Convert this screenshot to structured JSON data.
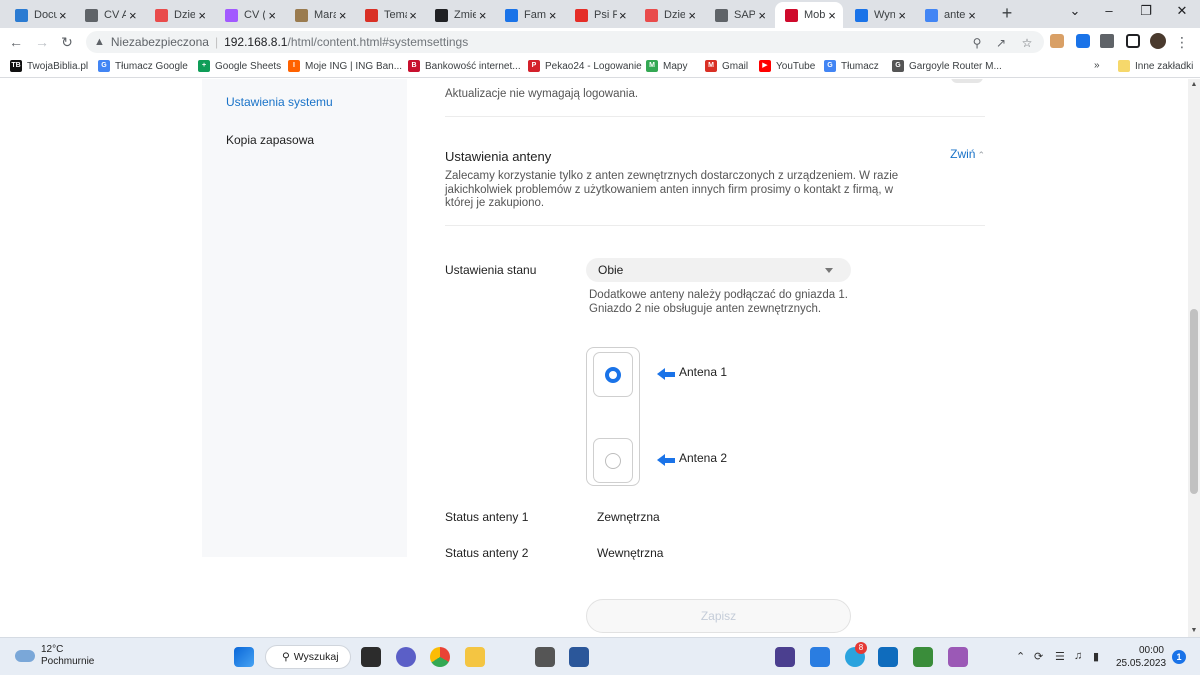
{
  "browser": {
    "tabs": [
      {
        "title": "Docu",
        "icon": "vscode-icon",
        "color": "#2b7bd2"
      },
      {
        "title": "CV A",
        "icon": "globe-icon",
        "color": "#5f6368"
      },
      {
        "title": "Dzie",
        "icon": "youtube-icon",
        "color": "#e94b4b"
      },
      {
        "title": "CV (",
        "icon": "figma-icon",
        "color": "#a259ff"
      },
      {
        "title": "Mara",
        "icon": "link-icon",
        "color": "#9a7b4f"
      },
      {
        "title": "Tema",
        "icon": "gmail-icon",
        "color": "#d93025"
      },
      {
        "title": "Zmie",
        "icon": "edge-icon",
        "color": "#202124"
      },
      {
        "title": "Fami",
        "icon": "globe-icon",
        "color": "#1a73e8"
      },
      {
        "title": "Psi P",
        "icon": "youtube-icon",
        "color": "#e52d27"
      },
      {
        "title": "Dzie",
        "icon": "youtube-icon",
        "color": "#e94b4b"
      },
      {
        "title": "SAP",
        "icon": "globe-icon",
        "color": "#5f6368"
      },
      {
        "title": "Mob",
        "icon": "huawei-icon",
        "color": "#cf0a2c",
        "active": true
      },
      {
        "title": "Wyn",
        "icon": "speedometer-icon",
        "color": "#1a73e8"
      },
      {
        "title": "ante",
        "icon": "google-icon",
        "color": "#4285f4"
      }
    ],
    "new_tab": "+",
    "window_controls": [
      "⌄",
      "–",
      "❐",
      "✕"
    ],
    "omnibox": {
      "security_label": "Niezabezpieczona",
      "host": "192.168.8.1",
      "path": "/html/content.html#systemsettings"
    },
    "bookmarks": [
      {
        "label": "TwojaBiblia.pl",
        "badge": "TB",
        "color": "#111111"
      },
      {
        "label": "Tłumacz Google",
        "badge": "G",
        "color": "#4285f4"
      },
      {
        "label": "Google Sheets",
        "badge": "+",
        "color": "#0f9d58"
      },
      {
        "label": "Moje ING | ING Ban...",
        "badge": "I",
        "color": "#ff6200"
      },
      {
        "label": "Bankowość internet...",
        "badge": "B",
        "color": "#c8102e"
      },
      {
        "label": "Pekao24 - Logowanie",
        "badge": "P",
        "color": "#d4212b"
      },
      {
        "label": "Mapy",
        "badge": "M",
        "color": "#34a853"
      },
      {
        "label": "Gmail",
        "badge": "M",
        "color": "#d93025"
      },
      {
        "label": "YouTube",
        "badge": "▶",
        "color": "#ff0000"
      },
      {
        "label": "Tłumacz",
        "badge": "G",
        "color": "#4285f4"
      },
      {
        "label": "Gargoyle Router M...",
        "badge": "G",
        "color": "#555555"
      }
    ],
    "bookmarks_overflow": "»",
    "other_bookmarks": "Inne zakładki"
  },
  "sidebar": {
    "items": [
      {
        "label": "Ustawienia systemu",
        "active": true
      },
      {
        "label": "Kopia zapasowa",
        "active": false
      }
    ]
  },
  "main": {
    "update_note": "Aktualizacje nie wymagają logowania.",
    "antenna_section": {
      "title": "Ustawienia anteny",
      "collapse_label": "Zwiń",
      "description": "Zalecamy korzystanie tylko z anten zewnętrznych dostarczonych z urządzeniem. W razie jakichkolwiek problemów z użytkowaniem anten innych firm prosimy o kontakt z firmą, w której je zakupiono."
    },
    "state_label": "Ustawienia stanu",
    "state_value": "Obie",
    "hint_line1": "Dodatkowe anteny należy podłączać do gniazda 1.",
    "hint_line2": "Gniazdo 2 nie obsługuje anten zewnętrznych.",
    "antennas": [
      {
        "label": "Antena 1",
        "selected": true
      },
      {
        "label": "Antena 2",
        "selected": false
      }
    ],
    "status": [
      {
        "label": "Status anteny 1",
        "value": "Zewnętrzna"
      },
      {
        "label": "Status anteny 2",
        "value": "Wewnętrzna"
      }
    ],
    "save_label": "Zapisz"
  },
  "taskbar": {
    "weather_temp": "12°C",
    "weather_desc": "Pochmurnie",
    "search_label": "Wyszukaj",
    "telegram_badge": "8",
    "time": "00:00",
    "date": "25.05.2023",
    "notification_count": "1"
  }
}
